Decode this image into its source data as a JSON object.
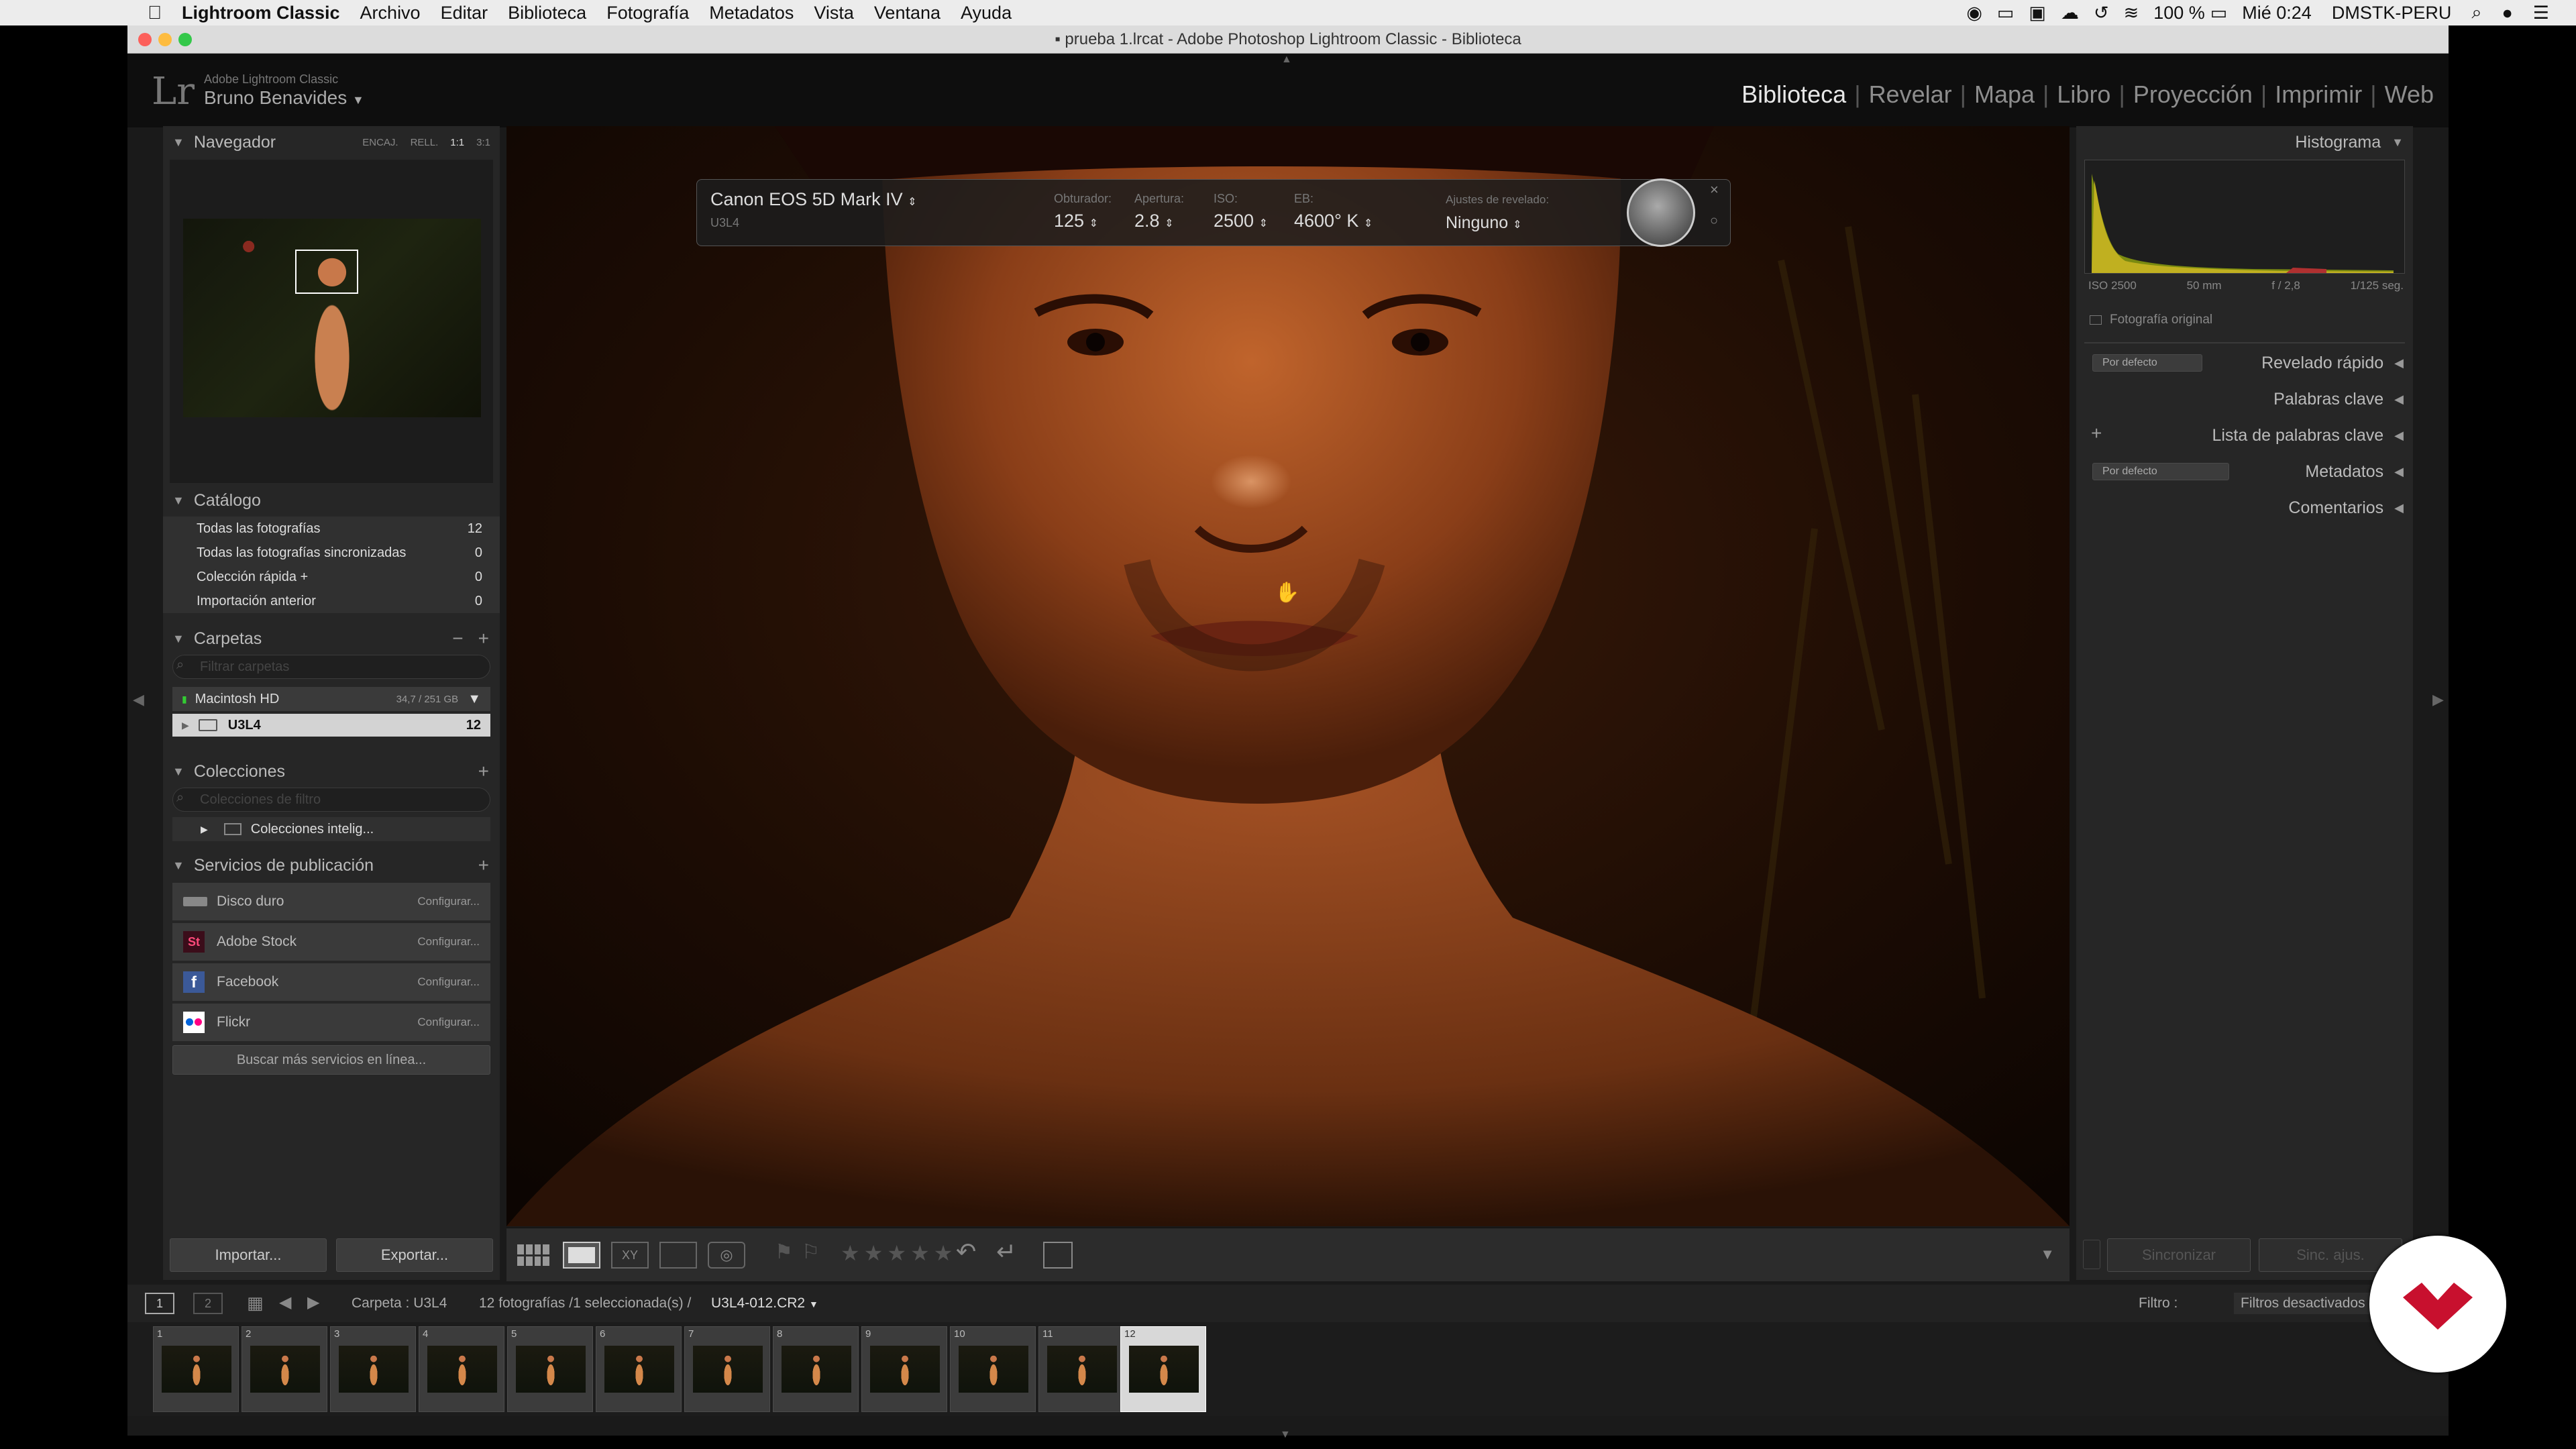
{
  "menubar": {
    "app": "Lightroom Classic",
    "items": [
      "Archivo",
      "Editar",
      "Biblioteca",
      "Fotografía",
      "Metadatos",
      "Vista",
      "Ventana",
      "Ayuda"
    ],
    "battery": "100 %",
    "clock": "Mié 0:24",
    "user": "DMSTK-PERU"
  },
  "window": {
    "title": "prueba 1.lrcat - Adobe Photoshop Lightroom Classic - Biblioteca"
  },
  "identity": {
    "product": "Adobe Lightroom Classic",
    "user": "Bruno Benavides",
    "logo": "Lr"
  },
  "modules": [
    "Biblioteca",
    "Revelar",
    "Mapa",
    "Libro",
    "Proyección",
    "Imprimir",
    "Web"
  ],
  "navigator": {
    "title": "Navegador",
    "zoom": [
      "ENCAJ.",
      "RELL.",
      "1:1",
      "3:1"
    ]
  },
  "catalog": {
    "title": "Catálogo",
    "items": [
      {
        "label": "Todas las fotografías",
        "count": "12"
      },
      {
        "label": "Todas las fotografías sincronizadas",
        "count": "0"
      },
      {
        "label": "Colección rápida +",
        "count": "0"
      },
      {
        "label": "Importación anterior",
        "count": "0"
      }
    ]
  },
  "folders": {
    "title": "Carpetas",
    "search": "Filtrar carpetas",
    "volume": "Macintosh HD",
    "volume_size": "34,7 / 251 GB",
    "folder": "U3L4",
    "folder_count": "12"
  },
  "collections": {
    "title": "Colecciones",
    "search": "Colecciones de filtro",
    "smart": "Colecciones intelig..."
  },
  "publish": {
    "title": "Servicios de publicación",
    "services": [
      {
        "name": "Disco duro",
        "action": "Configurar..."
      },
      {
        "name": "Adobe Stock",
        "action": "Configurar..."
      },
      {
        "name": "Facebook",
        "action": "Configurar..."
      },
      {
        "name": "Flickr",
        "action": "Configurar..."
      }
    ],
    "more": "Buscar más servicios en línea..."
  },
  "left_buttons": {
    "import": "Importar...",
    "export": "Exportar..."
  },
  "hud": {
    "camera": "Canon EOS 5D Mark IV",
    "folder": "U3L4",
    "shutter_label": "Obturador:",
    "shutter": "125",
    "aperture_label": "Apertura:",
    "aperture": "2.8",
    "iso_label": "ISO:",
    "iso": "2500",
    "wb_label": "EB:",
    "wb": "4600° K",
    "preset_label": "Ajustes de revelado:",
    "preset": "Ninguno"
  },
  "histogram": {
    "title": "Histograma",
    "iso": "ISO 2500",
    "focal": "50 mm",
    "aperture": "f / 2,8",
    "shutter": "1/125 seg.",
    "original": "Fotografía original"
  },
  "right_panels": {
    "quick": "Revelado rápido",
    "quick_preset": "Por defecto",
    "keywords": "Palabras clave",
    "keyword_list": "Lista de palabras clave",
    "metadata": "Metadatos",
    "metadata_preset": "Por defecto",
    "comments": "Comentarios"
  },
  "right_buttons": {
    "sync": "Sincronizar",
    "sync_settings": "Sinc. ajus."
  },
  "filmbar": {
    "path_label": "Carpeta : U3L4",
    "count": "12 fotografías /1 seleccionada(s) /",
    "file": "U3L4-012.CR2",
    "filter_label": "Filtro :",
    "filter_value": "Filtros desactivados",
    "screens": [
      "1",
      "2"
    ]
  },
  "filmstrip": {
    "numbers": [
      "1",
      "2",
      "3",
      "4",
      "5",
      "6",
      "7",
      "8",
      "9",
      "10",
      "11",
      "12"
    ],
    "selected": "12"
  },
  "colors": {
    "accent": "#c8102e",
    "panel": "#262626",
    "bg": "#1a1a1a"
  }
}
